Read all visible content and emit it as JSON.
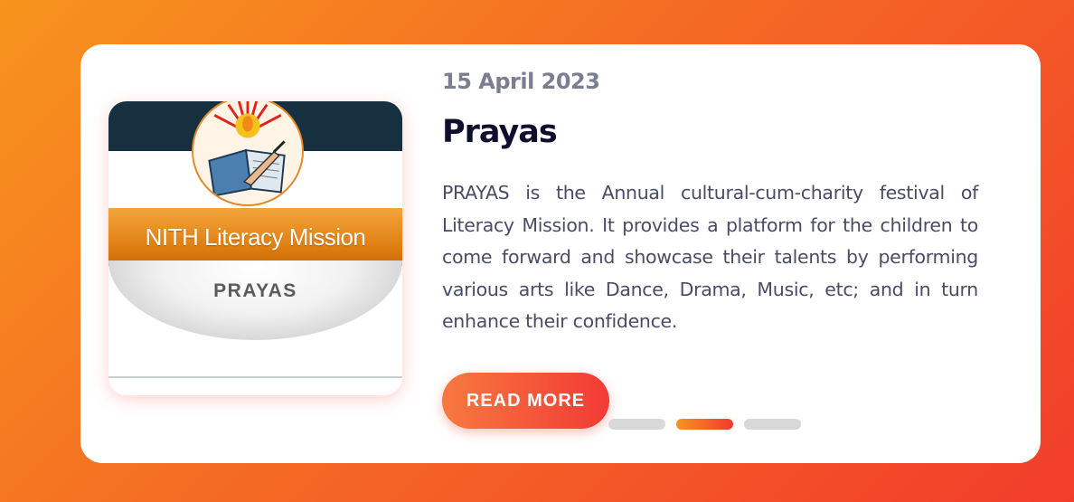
{
  "colors": {
    "background_start": "#f7941d",
    "background_end": "#f23d2b",
    "date": "#7b7d91",
    "title": "#0f0f2d",
    "text": "#4a4c66",
    "button_start": "#f7793f",
    "button_end": "#f23a36"
  },
  "event": {
    "image": {
      "banner_text": "NITH Literacy Mission",
      "subtitle_text": "PRAYAS",
      "emblem_icon": "lamp-book-emblem-icon"
    },
    "date": "15 April 2023",
    "title": "Prayas",
    "description": "PRAYAS is the Annual cultural-cum-charity festival of Literacy Mission. It provides a platform for the children to come forward and showcase their talents by performing various arts like Dance, Drama, Music, etc; and in turn enhance their confidence.",
    "read_more_label": "READ MORE"
  },
  "carousel": {
    "slide_count": 3,
    "active_index": 1
  }
}
